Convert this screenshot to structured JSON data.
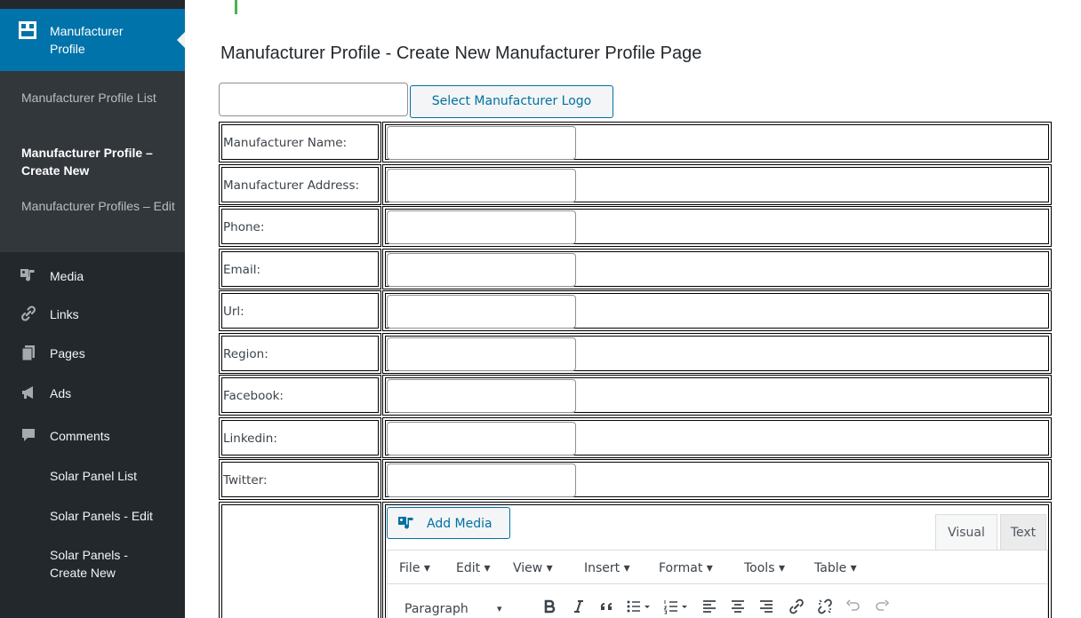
{
  "sidebar": {
    "current_menu": {
      "label": "Manufacturer Profile"
    },
    "submenu": [
      {
        "label": "Manufacturer Profile List",
        "active": false
      },
      {
        "label": "Manufacturer Profile – Create New",
        "active": true
      },
      {
        "label": "Manufacturer Profiles – Edit",
        "active": false
      }
    ],
    "menu": [
      {
        "label": "Media",
        "icon": "media-icon"
      },
      {
        "label": "Links",
        "icon": "link-icon"
      },
      {
        "label": "Pages",
        "icon": "pages-icon"
      },
      {
        "label": "Ads",
        "icon": "megaphone-icon"
      },
      {
        "label": "Comments",
        "icon": "comment-icon"
      },
      {
        "label": "Solar Panel List",
        "icon": ""
      },
      {
        "label": "Solar Panels - Edit",
        "icon": ""
      },
      {
        "label": "Solar Panels - Create New",
        "icon": ""
      }
    ]
  },
  "page": {
    "title": "Manufacturer Profile - Create New Manufacturer Profile Page",
    "logo_input_value": "",
    "logo_button": "Select Manufacturer Logo",
    "fields": [
      {
        "label": "Manufacturer Name:",
        "value": ""
      },
      {
        "label": "Manufacturer Address:",
        "value": ""
      },
      {
        "label": "Phone:",
        "value": ""
      },
      {
        "label": "Email:",
        "value": ""
      },
      {
        "label": "Url:",
        "value": ""
      },
      {
        "label": "Region:",
        "value": ""
      },
      {
        "label": "Facebook:",
        "value": ""
      },
      {
        "label": "Linkedin:",
        "value": ""
      },
      {
        "label": "Twitter:",
        "value": ""
      }
    ]
  },
  "editor": {
    "add_media": "Add Media",
    "tabs": {
      "visual": "Visual",
      "text": "Text"
    },
    "menubar": [
      "File ▾",
      "Edit ▾",
      "View ▾",
      "Insert ▾",
      "Format ▾",
      "Tools ▾",
      "Table ▾"
    ],
    "format_select": "Paragraph",
    "format_caret": "▾"
  },
  "colors": {
    "sidebar_bg": "#23282d",
    "submenu_bg": "#32373c",
    "accent": "#0073aa",
    "button_text": "#0071a1"
  }
}
